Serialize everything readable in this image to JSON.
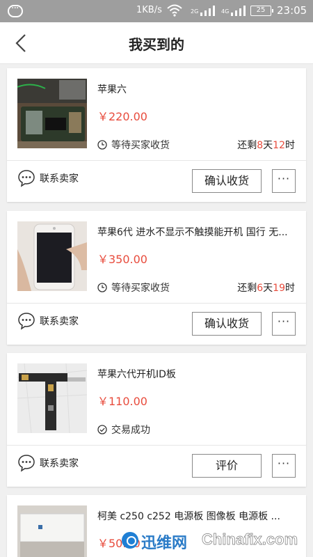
{
  "statusbar": {
    "speed": "1KB/s",
    "sim1": "2G",
    "sim2": "4G",
    "battery": "25",
    "time": "23:05"
  },
  "navbar": {
    "title": "我买到的"
  },
  "orders": [
    {
      "name": "苹果六",
      "price": "￥220.00",
      "status": "等待买家收货",
      "remain_prefix": "还剩",
      "remain_days": "8",
      "remain_days_unit": "天",
      "remain_hours": "12",
      "remain_hours_unit": "时",
      "contact": "联系卖家",
      "action": "确认收货",
      "more": "···"
    },
    {
      "name": "苹果6代 进水不显示不触摸能开机 国行 无...",
      "price": "￥350.00",
      "status": "等待买家收货",
      "remain_prefix": "还剩",
      "remain_days": "6",
      "remain_days_unit": "天",
      "remain_hours": "19",
      "remain_hours_unit": "时",
      "contact": "联系卖家",
      "action": "确认收货",
      "more": "···"
    },
    {
      "name": "苹果六代开机ID板",
      "price": "￥110.00",
      "status": "交易成功",
      "contact": "联系卖家",
      "action": "评价",
      "more": "···"
    },
    {
      "name": "柯美  c250   c252  电源板 图像板 电源板 ...",
      "price": "￥50.00"
    }
  ],
  "watermark": {
    "text1": "迅维网",
    "text2": "Chinafix.com"
  },
  "colors": {
    "price": "#e84c3d",
    "statusbar": "#9e9e9e"
  }
}
